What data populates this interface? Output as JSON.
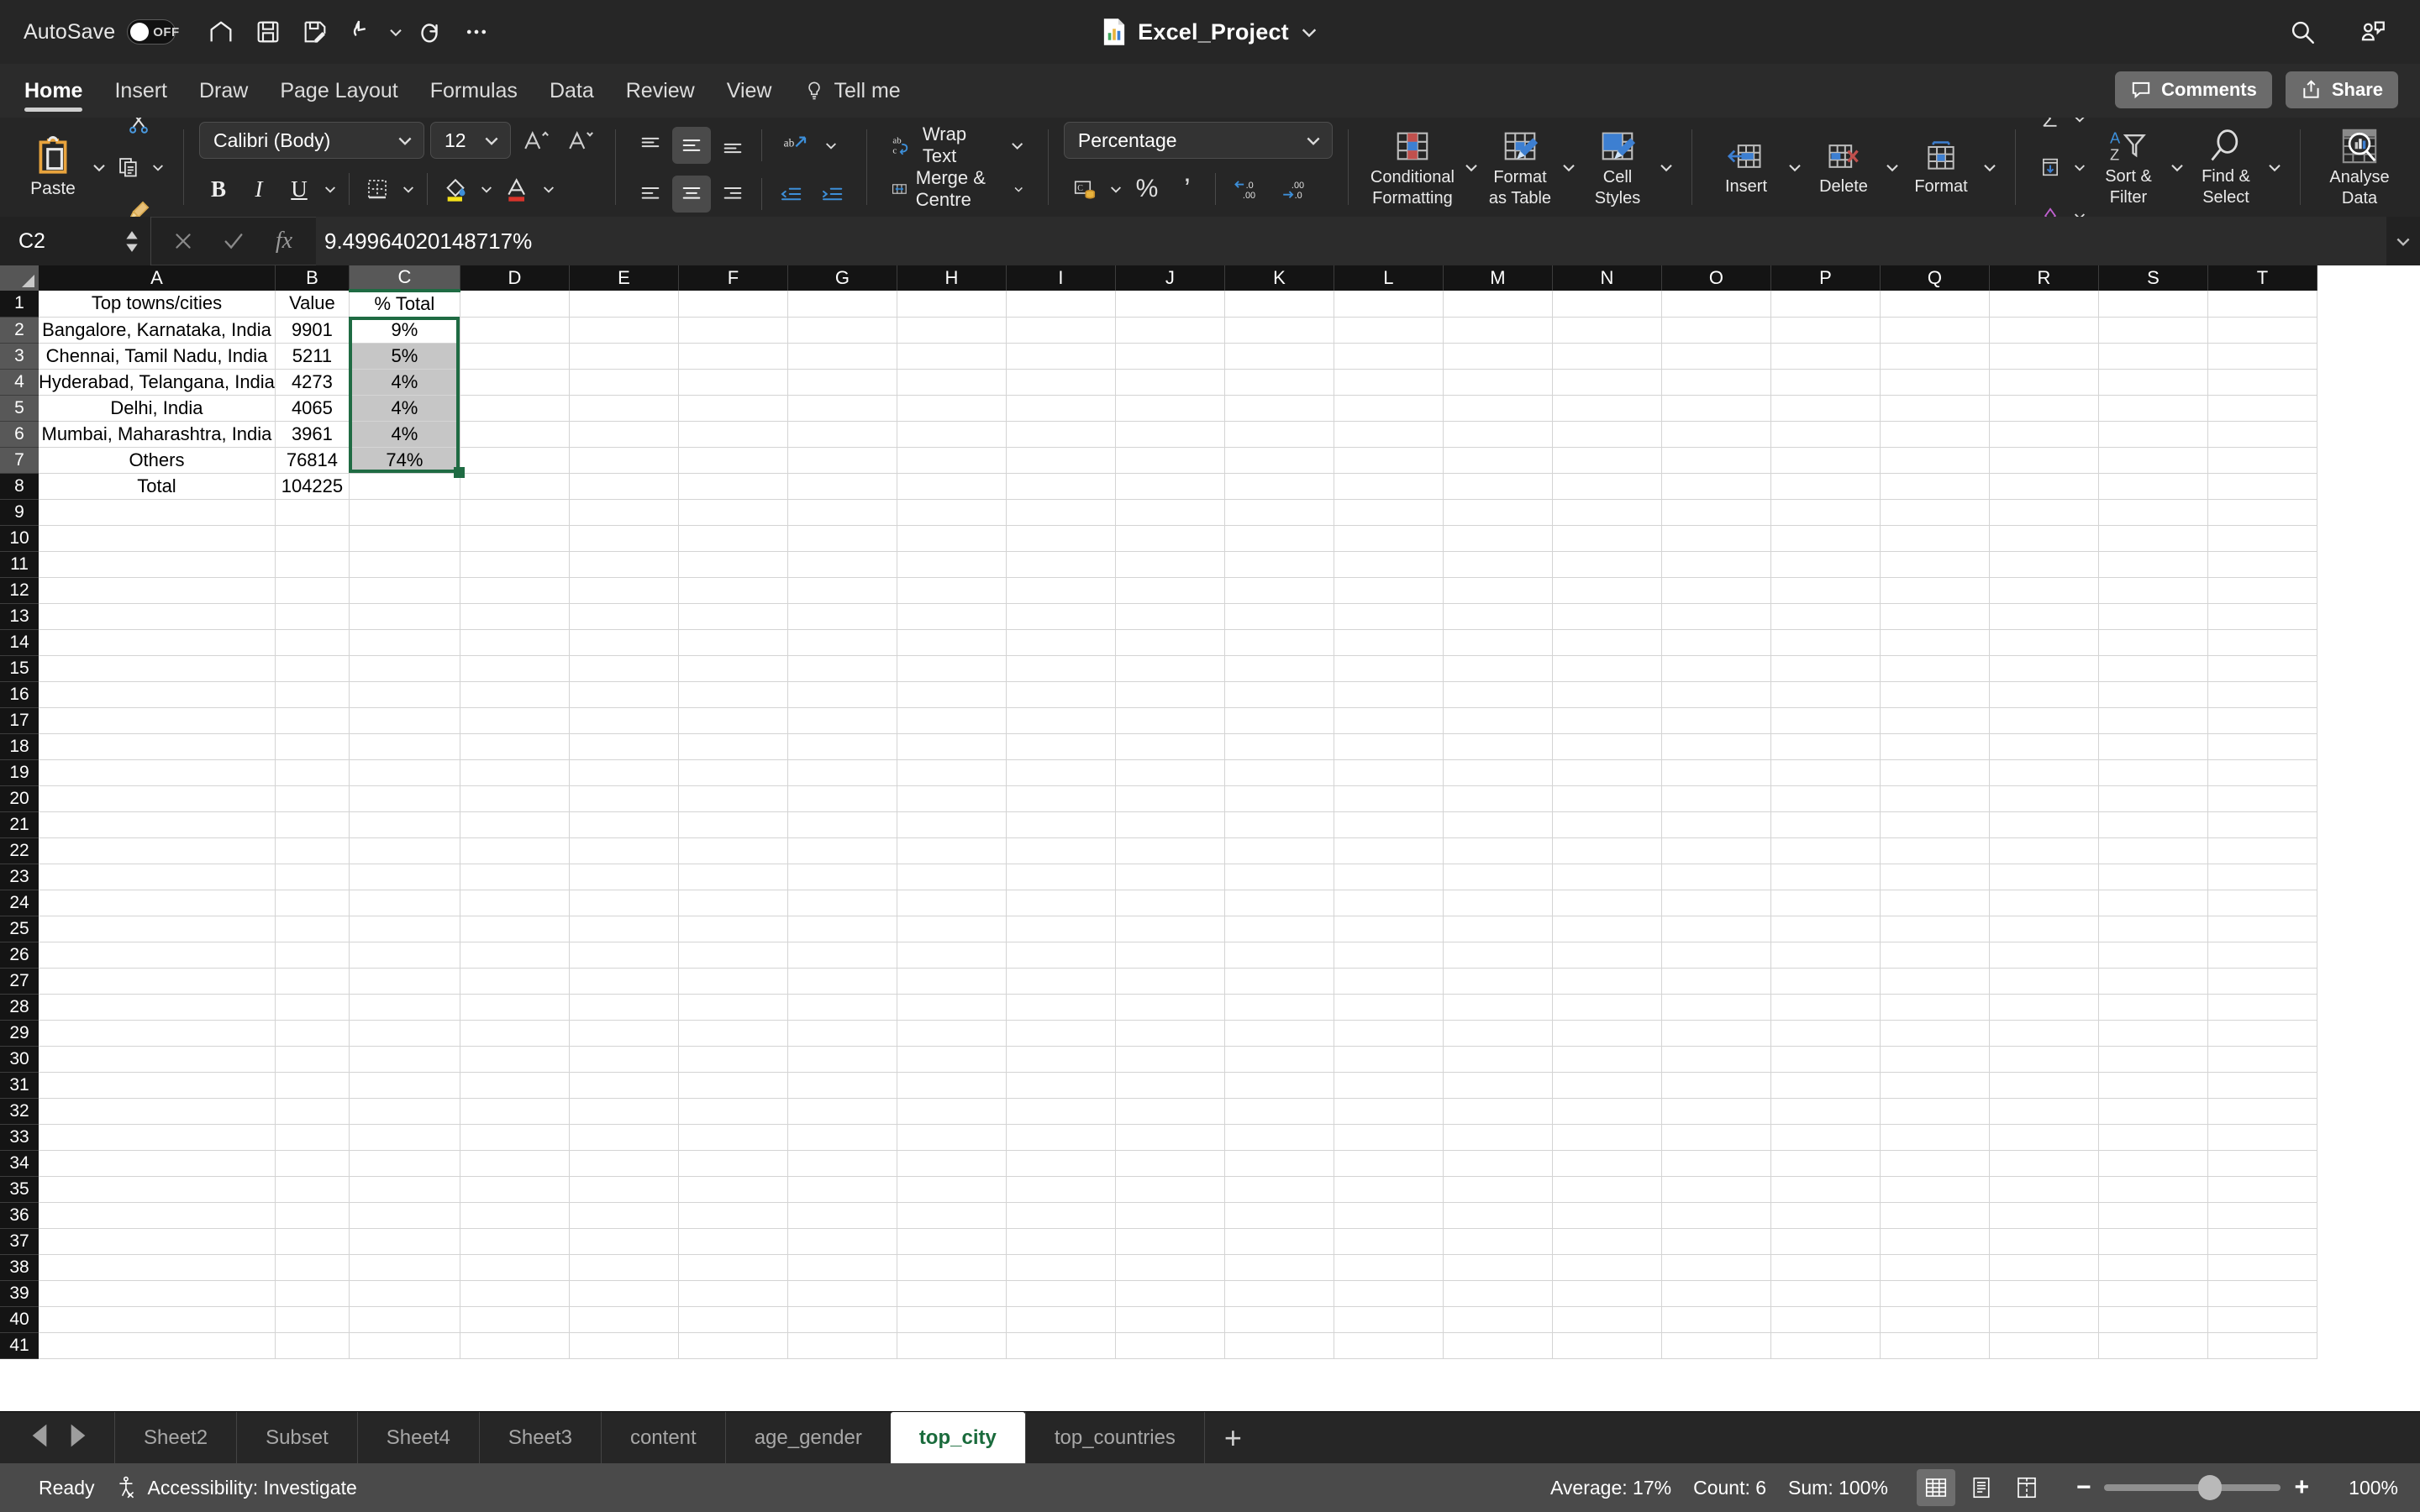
{
  "titlebar": {
    "autosave_label": "AutoSave",
    "autosave_state": "OFF",
    "document_title": "Excel_Project",
    "quick_access": [
      {
        "name": "home-icon",
        "tooltip": "Home"
      },
      {
        "name": "save-icon",
        "tooltip": "Save"
      },
      {
        "name": "save-as-icon",
        "tooltip": "Save As"
      },
      {
        "name": "undo-icon",
        "tooltip": "Undo"
      },
      {
        "name": "redo-icon",
        "tooltip": "Redo"
      },
      {
        "name": "more-icon",
        "tooltip": "More"
      }
    ],
    "search_icon": "search-icon",
    "account_icon": "account-icon"
  },
  "tabs": {
    "items": [
      "Home",
      "Insert",
      "Draw",
      "Page Layout",
      "Formulas",
      "Data",
      "Review",
      "View"
    ],
    "active": "Home",
    "tellme": "Tell me",
    "comments": "Comments",
    "share": "Share"
  },
  "ribbon": {
    "paste_label": "Paste",
    "font_name": "Calibri (Body)",
    "font_size": "12",
    "grow_font": "A",
    "shrink_font": "A",
    "bold": "B",
    "italic": "I",
    "underline": "U",
    "wrap_text": "Wrap Text",
    "merge_center": "Merge & Centre",
    "number_format": "Percentage",
    "conditional_formatting": "Conditional\nFormatting",
    "conditional_formatting_l1": "Conditional",
    "conditional_formatting_l2": "Formatting",
    "format_as_table_l1": "Format",
    "format_as_table_l2": "as Table",
    "cell_styles_l1": "Cell",
    "cell_styles_l2": "Styles",
    "insert": "Insert",
    "delete": "Delete",
    "format": "Format",
    "sort_filter_l1": "Sort &",
    "sort_filter_l2": "Filter",
    "find_select_l1": "Find &",
    "find_select_l2": "Select",
    "analyse_data_l1": "Analyse",
    "analyse_data_l2": "Data",
    "accent_blue": "#2f7fd1",
    "accent_yellow": "#f5e21a",
    "accent_red": "#d9342b",
    "accent_orange": "#e8a33d"
  },
  "formula_bar": {
    "name_box": "C2",
    "formula": "9.49964020148717%",
    "cancel_icon": "cancel-icon",
    "confirm_icon": "confirm-icon",
    "function_icon": "fx-icon"
  },
  "grid": {
    "columns": [
      "A",
      "B",
      "C",
      "D",
      "E",
      "F",
      "G",
      "H",
      "I",
      "J",
      "K",
      "L",
      "M",
      "N",
      "O",
      "P",
      "Q",
      "R",
      "S",
      "T"
    ],
    "selected_column": "C",
    "row_count": 41,
    "selected_rows": [
      2,
      3,
      4,
      5,
      6,
      7
    ],
    "active_cell": "C2",
    "selection_range": "C2:C7",
    "headers": [
      "Top towns/cities",
      "Value",
      "% Total"
    ],
    "rows": [
      {
        "row": 1,
        "a": "Top towns/cities",
        "b": "Value",
        "c": "% Total"
      },
      {
        "row": 2,
        "a": "Bangalore, Karnataka, India",
        "b": "9901",
        "c": "9%"
      },
      {
        "row": 3,
        "a": "Chennai, Tamil Nadu, India",
        "b": "5211",
        "c": "5%"
      },
      {
        "row": 4,
        "a": "Hyderabad, Telangana, India",
        "b": "4273",
        "c": "4%"
      },
      {
        "row": 5,
        "a": "Delhi, India",
        "b": "4065",
        "c": "4%"
      },
      {
        "row": 6,
        "a": "Mumbai, Maharashtra, India",
        "b": "3961",
        "c": "4%"
      },
      {
        "row": 7,
        "a": "Others",
        "b": "76814",
        "c": "74%"
      },
      {
        "row": 8,
        "a": "Total",
        "b": "104225",
        "c": ""
      }
    ],
    "selection_border_color": "#1f6b43"
  },
  "sheet_tabs": {
    "items": [
      "Sheet2",
      "Subset",
      "Sheet4",
      "Sheet3",
      "content",
      "age_gender",
      "top_city",
      "top_countries"
    ],
    "active": "top_city",
    "add_label": "+",
    "prev_icon": "prev-sheet-icon",
    "next_icon": "next-sheet-icon"
  },
  "status_bar": {
    "state": "Ready",
    "accessibility": "Accessibility: Investigate",
    "average": "Average: 17%",
    "count": "Count: 6",
    "sum": "Sum: 100%",
    "zoom": "100%",
    "views": [
      "normal-view-icon",
      "page-layout-icon",
      "page-break-icon"
    ],
    "active_view": "normal-view-icon",
    "zoom_out": "−",
    "zoom_in": "+"
  }
}
